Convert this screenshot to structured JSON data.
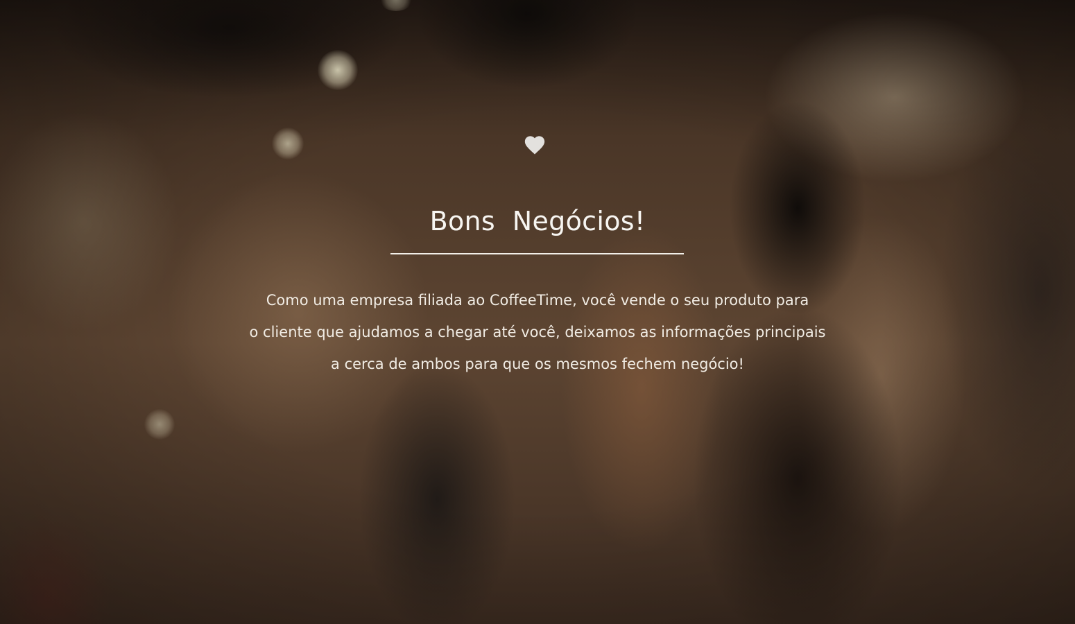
{
  "hero": {
    "icon": "heart-icon",
    "title": "Bons  Negócios!",
    "description_lines": [
      "Como uma empresa filiada ao CoffeeTime, você vende o seu produto para",
      "o cliente que ajudamos a chegar até você, deixamos as informações principais",
      "a cerca de ambos para que os mesmos fechem negócio!"
    ]
  },
  "colors": {
    "text": "#f4f2ee",
    "icon": "#e3e1de",
    "divider": "#f2efe9",
    "overlay": "#4a3627"
  }
}
